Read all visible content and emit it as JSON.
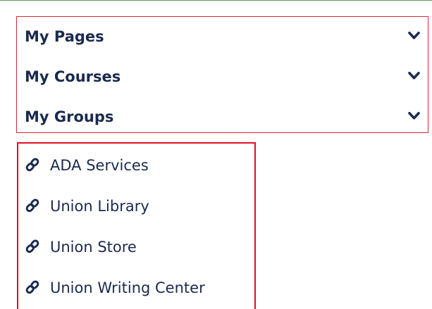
{
  "nav_sections": {
    "items": [
      {
        "label": "My Pages"
      },
      {
        "label": "My Courses"
      },
      {
        "label": "My Groups"
      }
    ],
    "expand_icon": "chevron-down-icon"
  },
  "quick_links": {
    "items": [
      {
        "label": "ADA Services",
        "icon": "link-icon"
      },
      {
        "label": "Union Library",
        "icon": "link-icon"
      },
      {
        "label": "Union Store",
        "icon": "link-icon"
      },
      {
        "label": "Union Writing Center",
        "icon": "link-icon"
      }
    ]
  },
  "colors": {
    "text": "#1b2a4e",
    "panel_border": "#d62b34",
    "links_border": "#e40d1f",
    "top_rule": "#5b9c4b"
  }
}
